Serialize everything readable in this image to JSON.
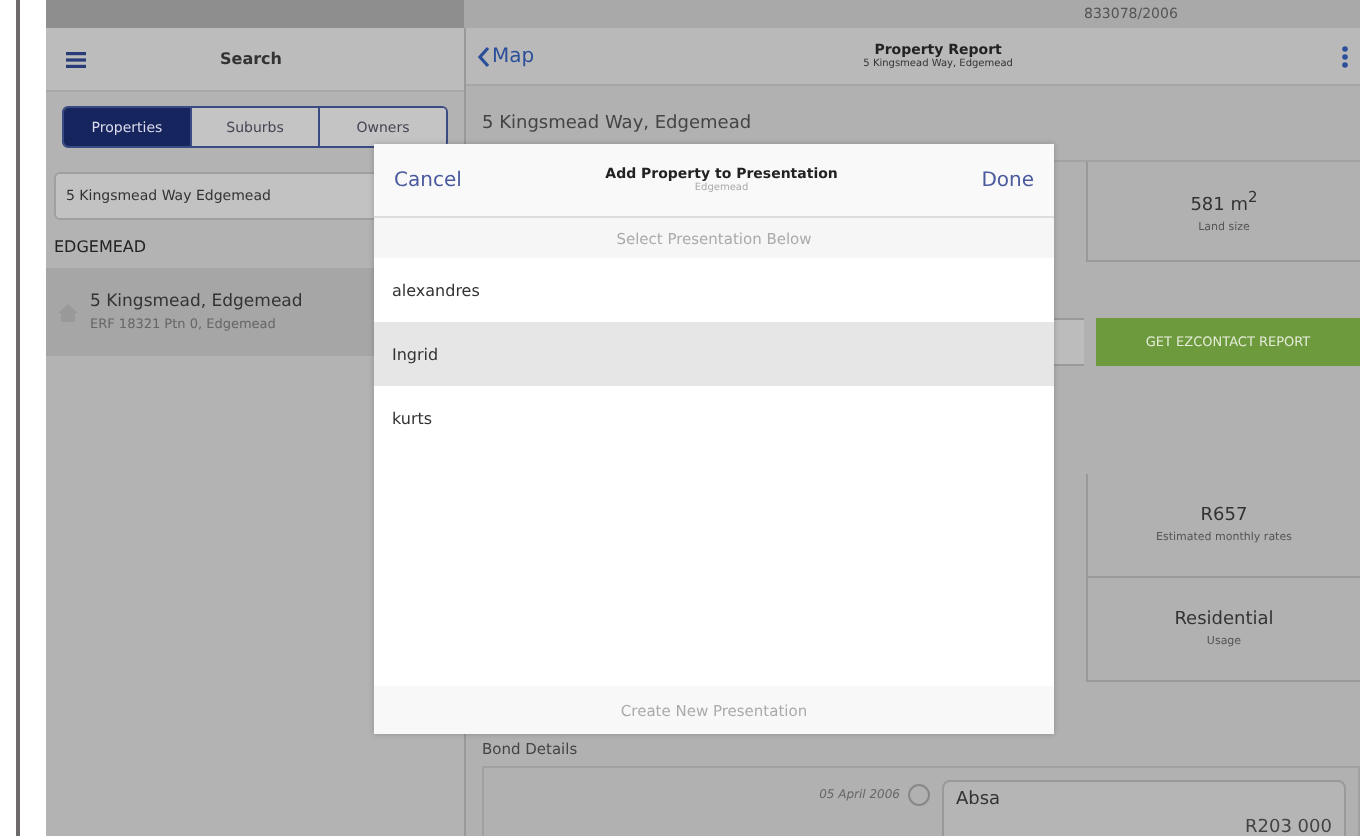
{
  "background_strip": {
    "text": "833078/2006"
  },
  "sidebar": {
    "title": "Search",
    "segments": [
      {
        "label": "Properties",
        "selected": true
      },
      {
        "label": "Suburbs",
        "selected": false
      },
      {
        "label": "Owners",
        "selected": false
      }
    ],
    "search": {
      "value": "5 Kingsmead Way Edgemead"
    },
    "section": "EDGEMEAD",
    "results": [
      {
        "title": "5 Kingsmead, Edgemead",
        "subtitle": "ERF 18321 Ptn 0, Edgemead"
      }
    ]
  },
  "report": {
    "back": "Map",
    "title": "Property Report",
    "subtitle": "5 Kingsmead Way, Edgemead",
    "address": "5 Kingsmead Way, Edgemead",
    "stats": [
      {
        "value": "581 m$^{2}$",
        "label": "Land size"
      },
      {
        "value": "R657",
        "label": "Estimated monthly rates"
      },
      {
        "value": "Residential",
        "label": "Usage"
      }
    ],
    "action_button": "GET EZCONTACT REPORT",
    "bond_heading": "Bond Details",
    "bonds": [
      {
        "date": "05 April 2006",
        "bank": "Absa",
        "amount": "R203 000"
      }
    ]
  },
  "dialog": {
    "cancel": "Cancel",
    "title": "Add Property to Presentation",
    "subtitle": "Edgemead",
    "done": "Done",
    "prompt": "Select Presentation Below",
    "items": [
      {
        "label": "alexandres",
        "selected": false
      },
      {
        "label": "Ingrid",
        "selected": true
      },
      {
        "label": "kurts",
        "selected": false
      }
    ],
    "footer": "Create New Presentation"
  }
}
